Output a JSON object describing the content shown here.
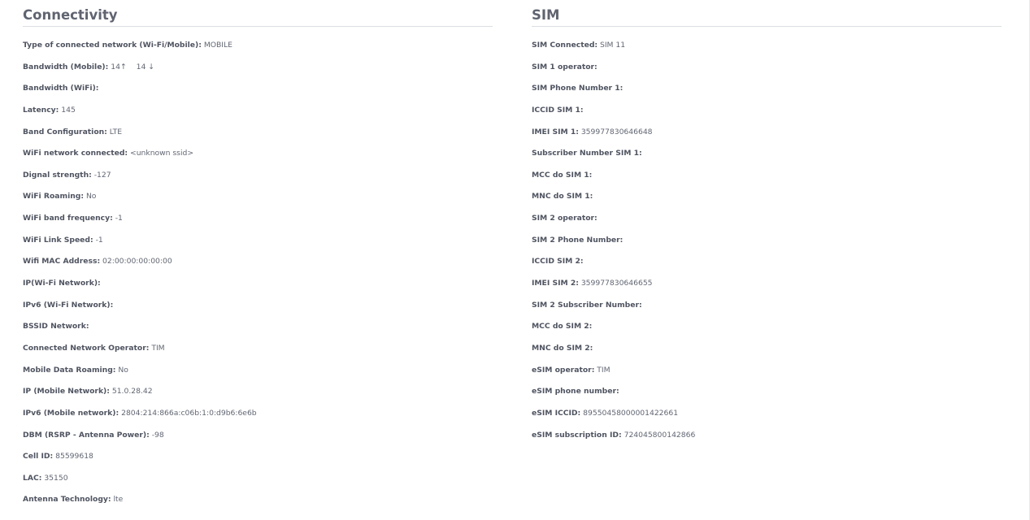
{
  "connectivity": {
    "title": "Connectivity",
    "rows": [
      {
        "label": "Type of connected network (Wi-Fi/Mobile):",
        "value": "MOBILE"
      },
      {
        "label": "Bandwidth (Mobile):",
        "up_value": "14",
        "up_icon": "↑",
        "down_value": "14",
        "down_icon": "↓"
      },
      {
        "label": "Bandwidth (WiFi):",
        "value": ""
      },
      {
        "label": "Latency:",
        "value": "145"
      },
      {
        "label": "Band Configuration:",
        "value": "LTE"
      },
      {
        "label": "WiFi network connected:",
        "value": "<unknown ssid>"
      },
      {
        "label": "Dignal strength:",
        "value": "-127"
      },
      {
        "label": "WiFi Roaming:",
        "value": "No"
      },
      {
        "label": "WiFi band frequency:",
        "value": "-1"
      },
      {
        "label": "WiFi Link Speed:",
        "value": "-1"
      },
      {
        "label": "Wifi MAC Address:",
        "value": "02:00:00:00:00:00"
      },
      {
        "label": "IP(Wi-Fi Network):",
        "value": ""
      },
      {
        "label": "IPv6 (Wi-Fi Network):",
        "value": ""
      },
      {
        "label": "BSSID Network:",
        "value": ""
      },
      {
        "label": "Connected Network Operator:",
        "value": "TIM"
      },
      {
        "label": "Mobile Data Roaming:",
        "value": "No"
      },
      {
        "label": "IP (Mobile Network):",
        "value": "51.0.28.42"
      },
      {
        "label": "IPv6 (Mobile network):",
        "value": "2804:214:866a:c06b:1:0:d9b6:6e6b"
      },
      {
        "label": "DBM (RSRP - Antenna Power):",
        "value": "-98"
      },
      {
        "label": "Cell ID:",
        "value": "85599618"
      },
      {
        "label": "LAC:",
        "value": "35150"
      },
      {
        "label": "Antenna Technology:",
        "value": "lte"
      }
    ]
  },
  "sim": {
    "title": "SIM",
    "rows": [
      {
        "label": "SIM Connected:",
        "value": "SIM 11"
      },
      {
        "label": "SIM 1 operator:",
        "value": ""
      },
      {
        "label": "SIM Phone Number 1:",
        "value": ""
      },
      {
        "label": "ICCID SIM 1:",
        "value": ""
      },
      {
        "label": "IMEI SIM 1:",
        "value": "359977830646648"
      },
      {
        "label": "Subscriber Number SIM 1:",
        "value": ""
      },
      {
        "label": "MCC do SIM 1:",
        "value": ""
      },
      {
        "label": "MNC do SIM 1:",
        "value": ""
      },
      {
        "label": "SIM 2 operator:",
        "value": ""
      },
      {
        "label": "SIM 2 Phone Number:",
        "value": ""
      },
      {
        "label": "ICCID SIM 2:",
        "value": ""
      },
      {
        "label": "IMEI SIM 2:",
        "value": "359977830646655"
      },
      {
        "label": "SIM 2 Subscriber Number:",
        "value": ""
      },
      {
        "label": "MCC do SIM 2:",
        "value": ""
      },
      {
        "label": "MNC do SIM 2:",
        "value": ""
      },
      {
        "label": "eSIM operator:",
        "value": "TIM"
      },
      {
        "label": "eSIM phone number:",
        "value": ""
      },
      {
        "label": "eSIM ICCID:",
        "value": "89550458000001422661"
      },
      {
        "label": "eSIM subscription ID:",
        "value": "724045800142866"
      }
    ]
  }
}
